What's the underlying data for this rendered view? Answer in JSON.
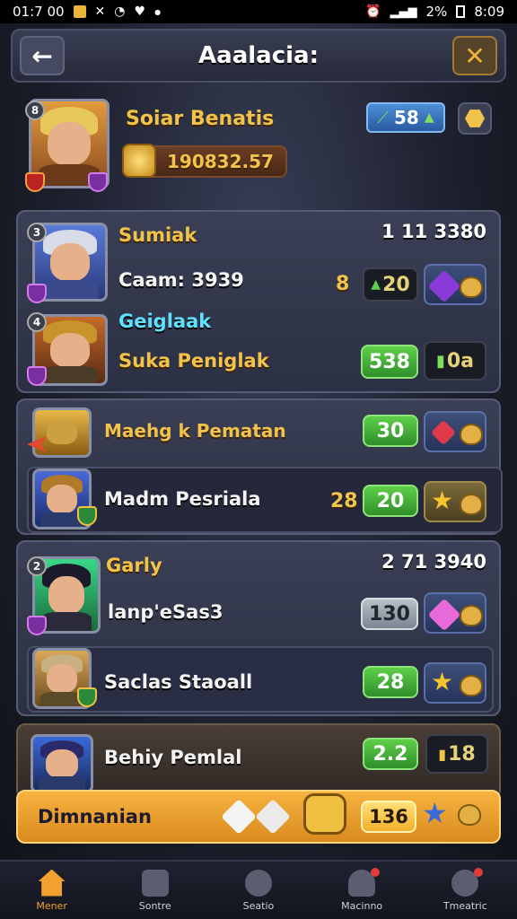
{
  "status_bar": {
    "time_left": "01:7 00",
    "battery": "2%",
    "time_right": "8:09"
  },
  "header": {
    "title": "Aaalacia:",
    "back_icon": "arrow-left-icon",
    "close_icon": "close-x-icon"
  },
  "player": {
    "level": "8",
    "name": "Soiar Benatis",
    "coins": "190832.57",
    "energy": "58",
    "badge_icon": "shield-icon"
  },
  "group1": {
    "rank_score": "1 11 3380",
    "rows": [
      {
        "level": "3",
        "name": "Sumiak",
        "sub": "Caam: 3939",
        "side_num": "8",
        "value": "20",
        "slot": "gem-pet"
      },
      {
        "level": "4",
        "name": "Geiglaak",
        "sub": "Suka Peniglak",
        "side_num": "",
        "value": "538",
        "slot_text": "0a"
      }
    ]
  },
  "group2": {
    "rows": [
      {
        "name": "Maehg k Pematan",
        "value": "30"
      },
      {
        "name": "Madm Pesriala",
        "side_num": "28",
        "value": "20"
      }
    ]
  },
  "group3": {
    "rank_score": "2 71 3940",
    "rows": [
      {
        "level": "2",
        "name": "Garly",
        "sub": "lanp'eSas3",
        "value": "130"
      },
      {
        "name": "Saclas Staoall",
        "value": "28"
      }
    ]
  },
  "group4": {
    "rows": [
      {
        "name": "Behiy Pemlal",
        "value": "2.2",
        "slot_text": "18"
      }
    ]
  },
  "highlight": {
    "name": "Dimnanian",
    "value": "136"
  },
  "bottom_nav": [
    {
      "label": "Mener",
      "icon": "home-icon",
      "active": true
    },
    {
      "label": "Sontre",
      "icon": "book-icon",
      "active": false
    },
    {
      "label": "Seatio",
      "icon": "compass-icon",
      "active": false
    },
    {
      "label": "Macinno",
      "icon": "profile-icon",
      "active": false
    },
    {
      "label": "Tmeatric",
      "icon": "chat-icon",
      "active": false
    }
  ]
}
